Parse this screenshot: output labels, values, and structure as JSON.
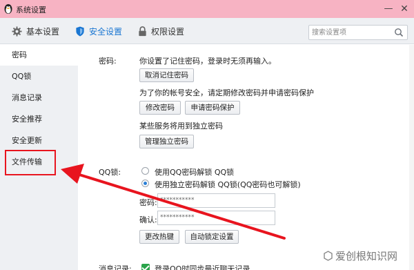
{
  "window": {
    "title": "系统设置",
    "minimize_glyph": "—",
    "close_glyph": "✕"
  },
  "tabs": [
    {
      "label": "基本设置",
      "icon": "gear-icon"
    },
    {
      "label": "安全设置",
      "icon": "shield-icon",
      "active": true
    },
    {
      "label": "权限设置",
      "icon": "lock-icon"
    }
  ],
  "search": {
    "placeholder": "搜索设置项"
  },
  "sidebar": {
    "items": [
      {
        "label": "密码",
        "active": true
      },
      {
        "label": "QQ锁"
      },
      {
        "label": "消息记录"
      },
      {
        "label": "安全推荐"
      },
      {
        "label": "安全更新"
      },
      {
        "label": "文件传输",
        "highlighted": true
      }
    ]
  },
  "password": {
    "label": "密码:",
    "remembered_text": "你设置了记住密码，登录时无须再输入。",
    "cancel_remember_button": "取消记住密码",
    "security_text": "为了你的帐号安全，请定期修改密码并申请密码保护",
    "change_button": "修改密码",
    "protect_button": "申请密码保护",
    "separate_text": "某些服务将用到独立密码",
    "manage_separate_button": "管理独立密码"
  },
  "qqlock": {
    "label": "QQ锁:",
    "option_qq_password": "使用QQ密码解锁 QQ锁",
    "option_separate_password": "使用独立密码解锁 QQ锁(QQ密码也可解锁)",
    "selected": "option_separate_password",
    "password_label": "密码:",
    "confirm_label": "确认:",
    "password_value": "***********",
    "confirm_value": "***********",
    "hotkey_button": "更改热键",
    "autolock_button": "自动锁定设置"
  },
  "message_record": {
    "label": "消息记录:",
    "checkbox_label": "登录QQ时同步最近聊天记录",
    "checked": true
  },
  "watermark": {
    "text": "爱创根知识网"
  },
  "colors": {
    "titlebar": "#f7b3c3",
    "accent": "#1a76d2",
    "annotation_red": "#e8141e",
    "sidebar_bg": "#eef0f3"
  }
}
